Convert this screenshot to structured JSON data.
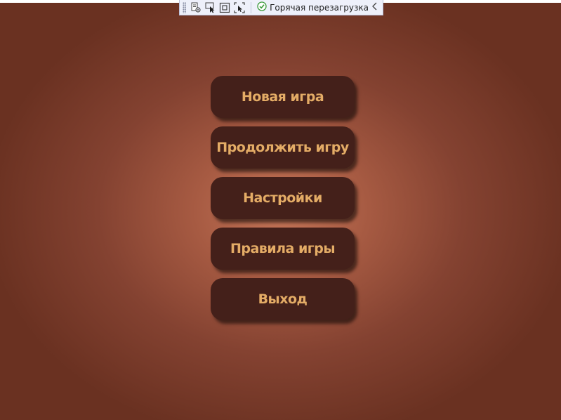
{
  "debug_toolbar": {
    "icons": [
      "live-visual-tree-icon",
      "select-element-icon",
      "display-layout-adorners-icon",
      "track-focused-element-icon"
    ],
    "hot_reload_label": "Горячая перезагрузка",
    "hot_reload_status_icon": "checkmark-circle-icon",
    "status_color": "#3a9a3a"
  },
  "menu": {
    "items": [
      {
        "label": "Новая игра"
      },
      {
        "label": "Продолжить игру"
      },
      {
        "label": "Настройки"
      },
      {
        "label": "Правила игры"
      },
      {
        "label": "Выход"
      }
    ]
  },
  "colors": {
    "button_bg": "#44201a",
    "button_text": "#e4ac66",
    "background_center": "#c57558",
    "background_edge": "#6a3121"
  }
}
